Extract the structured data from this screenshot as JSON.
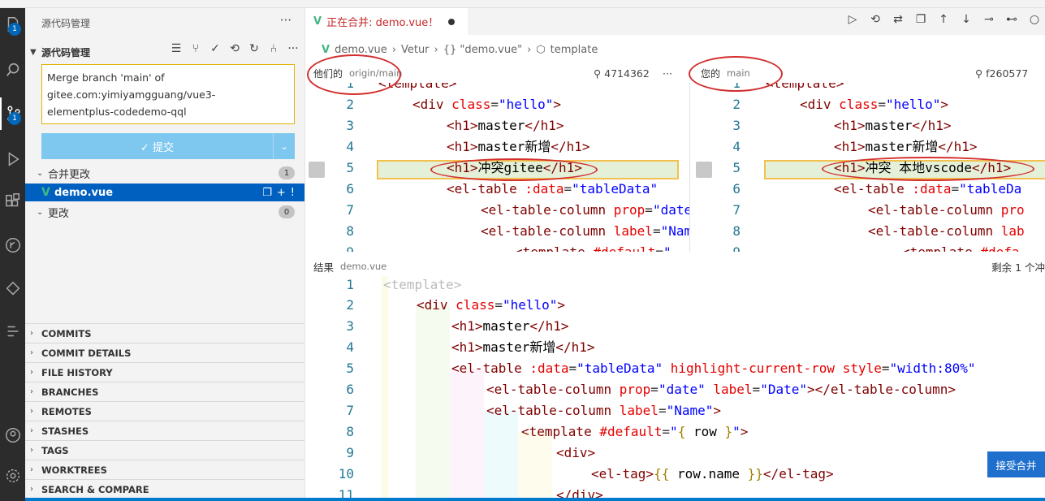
{
  "sidebar": {
    "title": "源代码管理",
    "section_label": "源代码管理",
    "commit_message": "Merge branch 'main' of\ngitee.com:yimiyamgguang/vue3-\nelementplus-codedemo-qql",
    "commit_button": "✓ 提交",
    "merge_changes": {
      "label": "合并更改",
      "count": "1"
    },
    "file": {
      "name": "demo.vue",
      "status": "!"
    },
    "changes": {
      "label": "更改",
      "count": "0"
    },
    "panels": [
      "COMMITS",
      "COMMIT DETAILS",
      "FILE HISTORY",
      "BRANCHES",
      "REMOTES",
      "STASHES",
      "TAGS",
      "WORKTREES",
      "SEARCH & COMPARE"
    ]
  },
  "activity_badges": {
    "explorer": "1",
    "scm": "1"
  },
  "tab": {
    "label": "正在合并: demo.vue！"
  },
  "breadcrumb": {
    "file": "demo.vue",
    "lang": "Vetur",
    "obj": "{} \"demo.vue\"",
    "node": "template"
  },
  "theirs": {
    "label": "他们的",
    "branch": "origin/main",
    "hash": "4714362"
  },
  "yours": {
    "label": "您的",
    "branch": "main",
    "hash": "f260577"
  },
  "result": {
    "label": "结果",
    "file": "demo.vue",
    "remaining": "剩余 1 个冲"
  },
  "accept_button": "接受合并",
  "colors": {
    "accent": "#007acc",
    "conflict": "#f2c14e",
    "annotation": "#d32f2f"
  }
}
